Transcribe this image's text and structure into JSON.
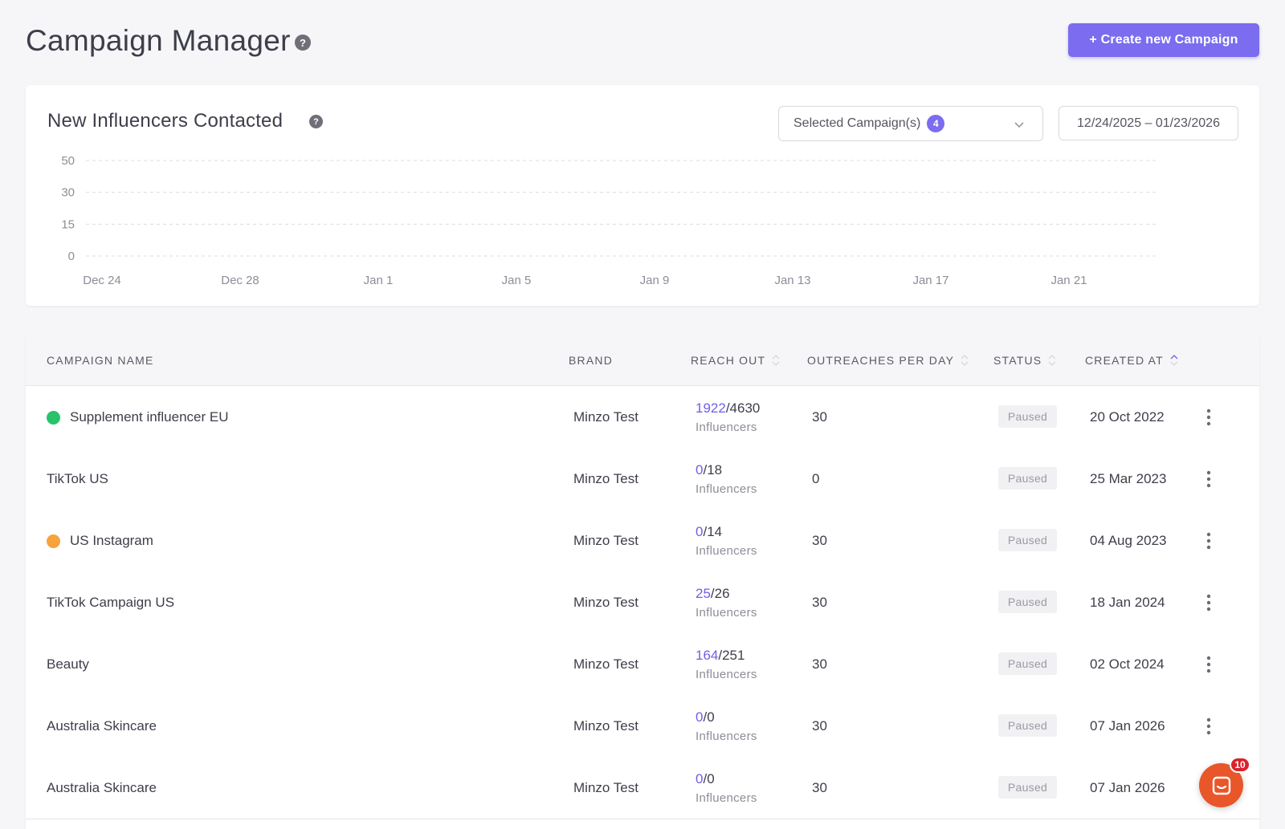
{
  "header": {
    "title": "Campaign Manager",
    "help_glyph": "?",
    "create_label": "+ Create new Campaign"
  },
  "chart_card": {
    "title": "New Influencers Contacted",
    "help_glyph": "?",
    "campaign_select_label": "Selected Campaign(s)",
    "campaign_select_count": "4",
    "date_range": "12/24/2025 – 01/23/2026"
  },
  "chart_data": {
    "type": "line",
    "y_ticks": [
      "50",
      "30",
      "15",
      "0"
    ],
    "x_ticks": [
      "Dec 24",
      "Dec 28",
      "Jan 1",
      "Jan 5",
      "Jan 9",
      "Jan 13",
      "Jan 17",
      "Jan 21"
    ],
    "series": [],
    "grid": "horizontal-dashed"
  },
  "table": {
    "columns": [
      "CAMPAIGN NAME",
      "BRAND",
      "REACH OUT",
      "OUTREACHES PER DAY",
      "STATUS",
      "CREATED AT"
    ],
    "rows": [
      {
        "dot": "#27c36b",
        "name": "Supplement influencer EU",
        "brand": "Minzo Test",
        "reached": "1922",
        "total": "/4630",
        "unit": "Influencers",
        "per_day": "30",
        "status": "Paused",
        "created": "20 Oct 2022"
      },
      {
        "dot": "",
        "name": "TikTok US",
        "brand": "Minzo Test",
        "reached": "0",
        "total": "/18",
        "unit": "Influencers",
        "per_day": "0",
        "status": "Paused",
        "created": "25 Mar 2023"
      },
      {
        "dot": "#f7a23b",
        "name": "US Instagram",
        "brand": "Minzo Test",
        "reached": "0",
        "total": "/14",
        "unit": "Influencers",
        "per_day": "30",
        "status": "Paused",
        "created": "04 Aug 2023"
      },
      {
        "dot": "",
        "name": "TikTok Campaign US",
        "brand": "Minzo Test",
        "reached": "25",
        "total": "/26",
        "unit": "Influencers",
        "per_day": "30",
        "status": "Paused",
        "created": "18 Jan 2024"
      },
      {
        "dot": "",
        "name": "Beauty",
        "brand": "Minzo Test",
        "reached": "164",
        "total": "/251",
        "unit": "Influencers",
        "per_day": "30",
        "status": "Paused",
        "created": "02 Oct 2024"
      },
      {
        "dot": "",
        "name": "Australia Skincare",
        "brand": "Minzo Test",
        "reached": "0",
        "total": "/0",
        "unit": "Influencers",
        "per_day": "30",
        "status": "Paused",
        "created": "07 Jan 2026"
      },
      {
        "dot": "",
        "name": "Australia Skincare",
        "brand": "Minzo Test",
        "reached": "0",
        "total": "/0",
        "unit": "Influencers",
        "per_day": "30",
        "status": "Paused",
        "created": "07 Jan 2026"
      }
    ]
  },
  "chat": {
    "badge": "10"
  },
  "colors": {
    "accent": "#7b6cf0",
    "chat": "#e8562a",
    "badge": "#d8232a"
  }
}
